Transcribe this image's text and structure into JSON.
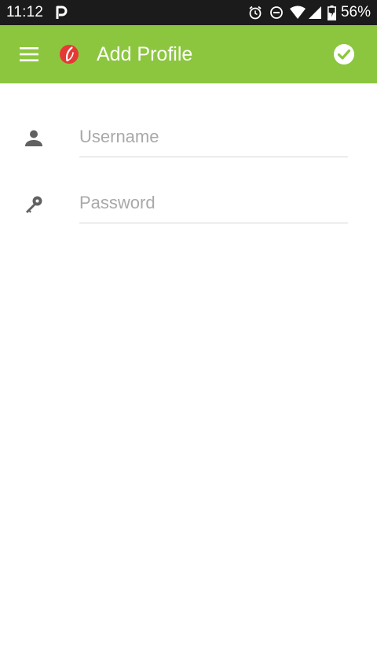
{
  "status_bar": {
    "time": "11:12",
    "battery": "56%",
    "icons": [
      "parking-app-icon",
      "alarm-icon",
      "do-not-disturb-icon",
      "wifi-icon",
      "cell-signal-icon",
      "battery-icon"
    ]
  },
  "app_bar": {
    "title": "Add Profile",
    "logo": "app-logo-icon",
    "left_icon": "menu-icon",
    "right_icon": "check-circle-icon"
  },
  "form": {
    "username": {
      "placeholder": "Username",
      "value": "",
      "icon": "person-icon"
    },
    "password": {
      "placeholder": "Password",
      "value": "",
      "icon": "key-icon"
    }
  },
  "colors": {
    "accent": "#8cc63f",
    "status_bar": "#1b1b1b",
    "logo_red": "#e53935",
    "icon_gray": "#616161",
    "placeholder": "#a9a9a9",
    "divider": "#d6d6d6"
  }
}
